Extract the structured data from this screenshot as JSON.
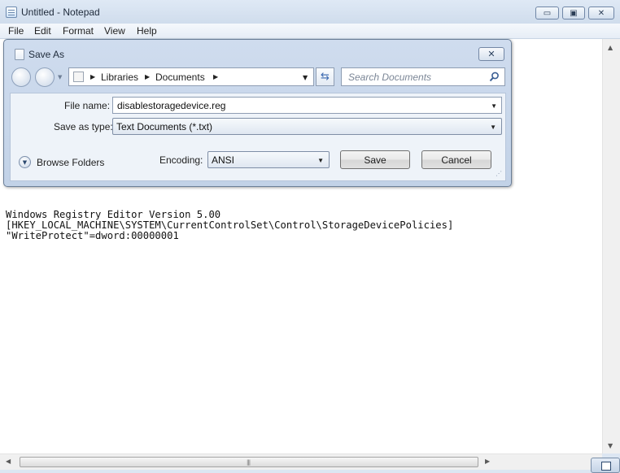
{
  "notepad": {
    "title": "Untitled - Notepad",
    "window_buttons": {
      "minimize": "▭",
      "maximize": "▣",
      "close": "✕"
    },
    "menu": [
      "File",
      "Edit",
      "Format",
      "View",
      "Help"
    ],
    "content_lines": [
      "Windows Registry Editor Version 5.00",
      "[HKEY_LOCAL_MACHINE\\SYSTEM\\CurrentControlSet\\Control\\StorageDevicePolicies]",
      "\"WriteProtect\"=dword:00000001"
    ]
  },
  "dialog": {
    "title": "Save As",
    "close_glyph": "✕",
    "breadcrumb": [
      "Libraries",
      "Documents"
    ],
    "search_placeholder": "Search Documents",
    "file_name_label": "File name:",
    "file_name_value": "disablestoragedevice.reg",
    "save_as_type_label": "Save as type:",
    "save_as_type_value": "Text Documents (*.txt)",
    "browse_folders": "Browse Folders",
    "encoding_label": "Encoding:",
    "encoding_value": "ANSI",
    "save_button": "Save",
    "cancel_button": "Cancel"
  },
  "icons": {
    "dropdown": "▼",
    "breadcrumb_sep": "▶",
    "refresh": "⇆",
    "scroll_up": "▲",
    "scroll_down": "▼",
    "scroll_left": "◀",
    "scroll_right": "▶",
    "grip": "|||"
  },
  "colors": {
    "accent": "#3a68b0",
    "frame": "#dce6f2",
    "dialog_bg": "#c2d2e7"
  }
}
